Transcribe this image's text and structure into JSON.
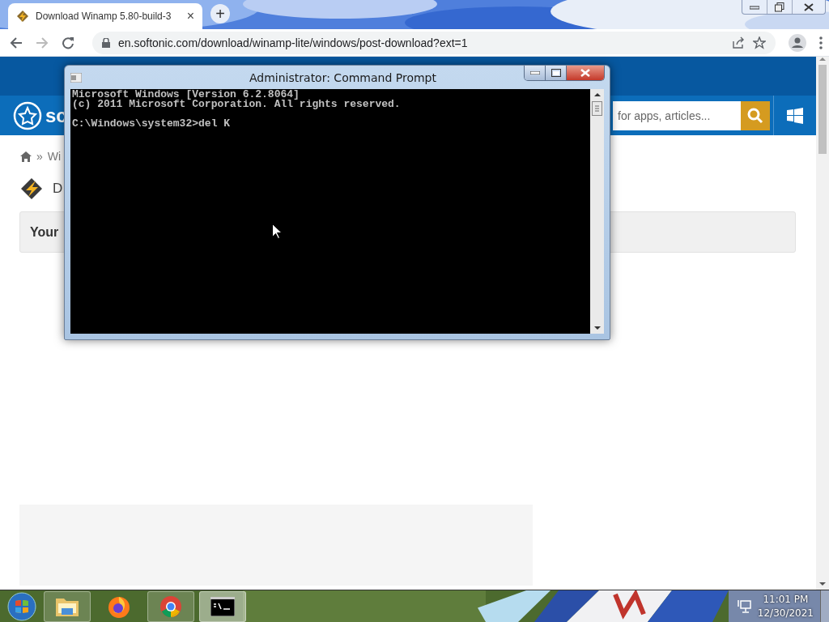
{
  "browser": {
    "tab": {
      "title": "Download Winamp 5.80-build-3",
      "close": "×",
      "selected": true
    },
    "new_tab": "+",
    "url": "en.softonic.com/download/winamp-lite/windows/post-download?ext=1"
  },
  "page": {
    "logo_text": "sc",
    "search": {
      "placeholder": "for apps, articles..."
    },
    "breadcrumb": {
      "separator": "»",
      "item": "Wi"
    },
    "app_title": "D",
    "notice": "Your"
  },
  "cmd": {
    "title": "Administrator: Command Prompt",
    "output": [
      "Microsoft Windows [Version 6.2.8064]",
      "(c) 2011 Microsoft Corporation. All rights reserved."
    ],
    "prompt": "C:\\Windows\\system32>del K"
  },
  "taskbar": {
    "apps": [
      {
        "kind": "explorer",
        "running": true,
        "selected": false
      },
      {
        "kind": "firefox",
        "running": false,
        "selected": false
      },
      {
        "kind": "chrome",
        "running": true,
        "selected": false
      },
      {
        "kind": "cmd",
        "running": true,
        "selected": true
      }
    ],
    "time": "11:01 PM",
    "date": "12/30/2021"
  }
}
